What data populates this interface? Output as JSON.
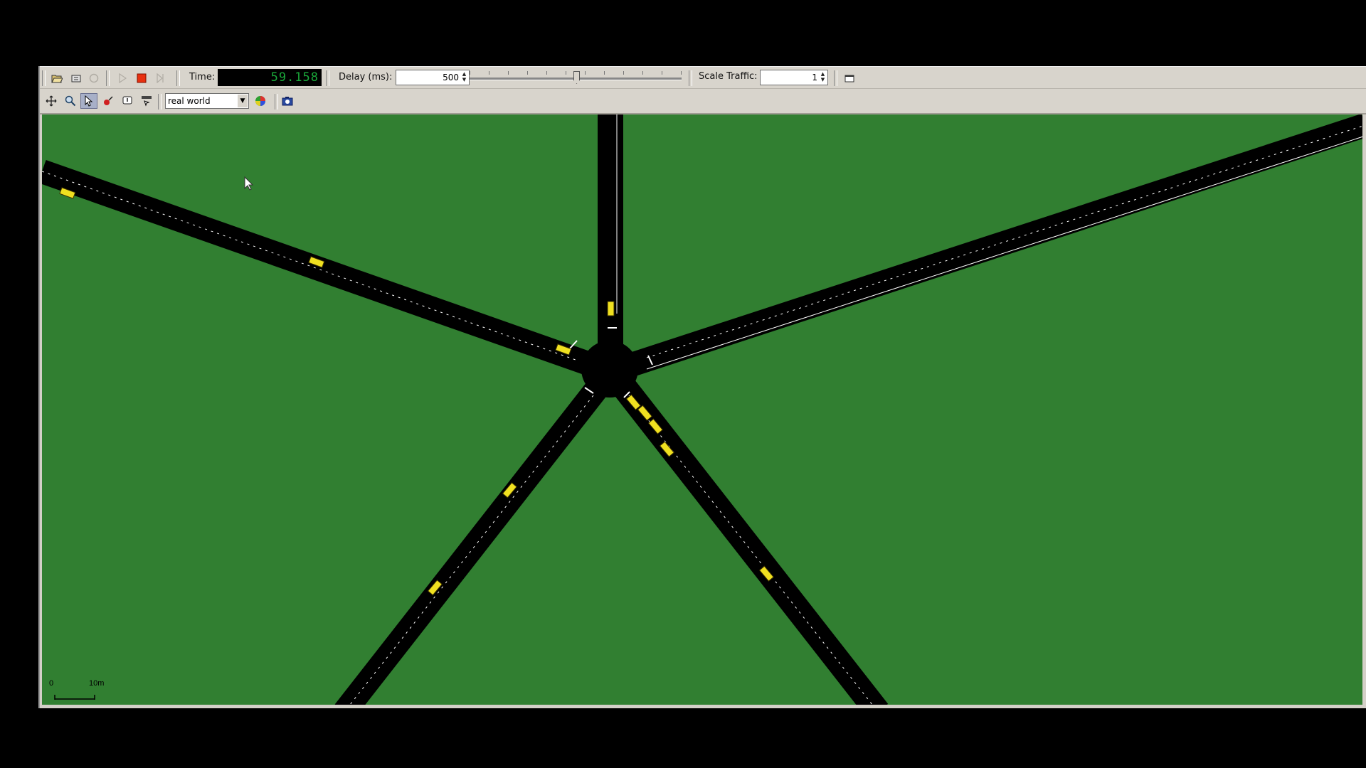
{
  "toolbar1": {
    "time_label": "Time:",
    "time_value": "59.158",
    "delay_label": "Delay (ms):",
    "delay_value": "500",
    "scale_label": "Scale Traffic:",
    "scale_value": "1",
    "buttons": {
      "open": "folder-open-icon",
      "reload": "reload-icon",
      "close": "close-sim-icon",
      "run": "play-icon",
      "stop": "stop-icon",
      "step": "step-icon",
      "window": "new-window-icon"
    },
    "colors": {
      "stop": "#e83010",
      "time_digits": "#1aa83a"
    }
  },
  "toolbar2": {
    "scheme_value": "real world",
    "buttons": {
      "recenter": "recenter-icon",
      "zoom": "magnifier-icon",
      "select": "cursor-select-icon",
      "locate": "locate-pin-icon",
      "tooltip": "tooltip-icon",
      "edit": "edit-menu-icon",
      "color": "color-wheel-icon",
      "screenshot": "camera-icon"
    }
  },
  "canvas": {
    "background": "#317f31",
    "road_color": "#000000",
    "vehicle_color": "#f0e020",
    "scale_zero": "0",
    "scale_length": "10m"
  }
}
